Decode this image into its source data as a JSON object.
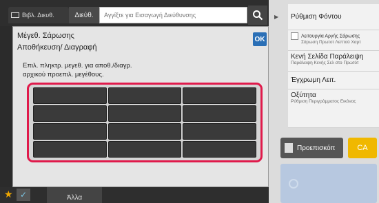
{
  "topbar": {
    "address_book_tab": "Βιβλ. Διευθ.",
    "address_tab": "Διεύθ.",
    "address_placeholder": "Αγγίξτε για Εισαγωγή Διεύθυνσης"
  },
  "dialog": {
    "title_line1": "Μέγεθ. Σάρωσης",
    "title_line2": "Αποθήκευση/ Διαγραφή",
    "ok_label": "OK",
    "instruction_line1": "Επιλ. πληκτρ. μεγεθ. για αποθ./διαγρ.",
    "instruction_line2": "αρχικού προεπιλ. μεγέθους.",
    "size_keys": [
      {
        "label": ""
      },
      {
        "label": ""
      },
      {
        "label": ""
      },
      {
        "label": ""
      },
      {
        "label": ""
      },
      {
        "label": ""
      },
      {
        "label": ""
      },
      {
        "label": ""
      },
      {
        "label": ""
      },
      {
        "label": ""
      },
      {
        "label": ""
      },
      {
        "label": ""
      }
    ],
    "highlight_color": "#e01a4b"
  },
  "right_panel": {
    "items": [
      {
        "title": "Ρύθμιση Φόντου",
        "sub": ""
      },
      {
        "title": "Λειτουργία Αργής Σάρωσης",
        "sub": "Σάρωση Πρωτοτ Λεπτού Χαρτ"
      },
      {
        "title": "Κενή Σελίδα Παράλειψη",
        "sub": "Παράλειψη Κενής Σελ στο Πρωτότ"
      },
      {
        "title": "Έγχρωμη Λειτ.",
        "sub": ""
      },
      {
        "title": "Οξύτητα",
        "sub": "Ρύθμιση Περιγράμματος Εικόνας"
      }
    ],
    "preview_label": "Προεπισκόπ",
    "ca_label": "CA",
    "start_label": ""
  },
  "bottombar": {
    "other_label": "Άλλα"
  },
  "colors": {
    "accent": "#2a6fb6",
    "ca": "#f0b800",
    "start": "#b7c8e0"
  }
}
